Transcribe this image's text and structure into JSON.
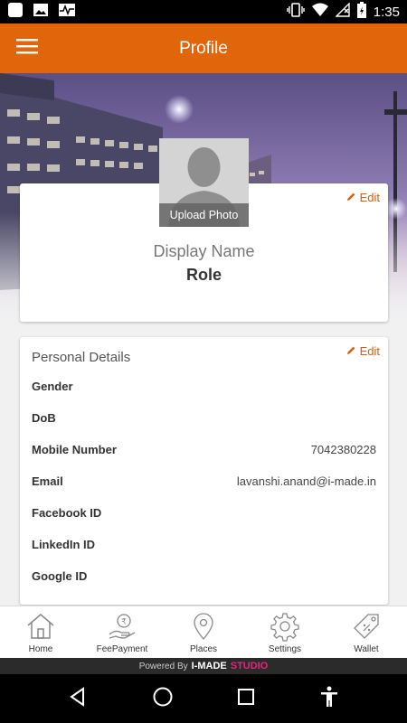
{
  "status_bar": {
    "time": "1:35",
    "icons": [
      "notification-icon",
      "image-icon",
      "activity-icon",
      "vibrate-icon",
      "wifi-icon",
      "no-sim-icon",
      "battery-icon"
    ]
  },
  "app_bar": {
    "title": "Profile",
    "menu_icon": "hamburger-icon",
    "color": "#e0650b"
  },
  "profile": {
    "upload_label": "Upload Photo",
    "edit_label": "Edit",
    "display_name": "Display Name",
    "role": "Role"
  },
  "personal_details": {
    "title": "Personal Details",
    "edit_label": "Edit",
    "rows": [
      {
        "label": "Gender",
        "value": ""
      },
      {
        "label": "DoB",
        "value": ""
      },
      {
        "label": "Mobile Number",
        "value": "7042380228"
      },
      {
        "label": "Email",
        "value": "lavanshi.anand@i-made.in"
      },
      {
        "label": "Facebook ID",
        "value": ""
      },
      {
        "label": "LinkedIn ID",
        "value": ""
      },
      {
        "label": "Google ID",
        "value": ""
      }
    ]
  },
  "bottom_nav": {
    "items": [
      {
        "label": "Home",
        "icon": "home-icon"
      },
      {
        "label": "FeePayment",
        "icon": "fee-payment-icon"
      },
      {
        "label": "Places",
        "icon": "location-pin-icon"
      },
      {
        "label": "Settings",
        "icon": "gear-icon"
      },
      {
        "label": "Wallet",
        "icon": "price-tag-icon"
      }
    ]
  },
  "footer": {
    "powered_by": "Powered By",
    "brand": "I-MADE",
    "brand_suffix": "STUDIO"
  },
  "system_nav": {
    "icons": [
      "back-icon",
      "home-circle-icon",
      "recents-icon",
      "accessibility-icon"
    ]
  }
}
